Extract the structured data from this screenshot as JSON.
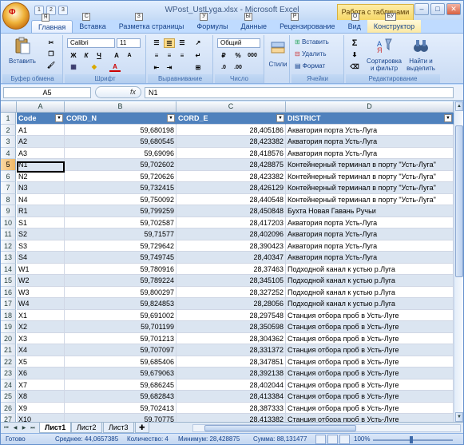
{
  "window": {
    "title": "WPost_UstLyga.xlsx - Microsoft Excel",
    "context_header": "Работа с таблицами",
    "controls": [
      "–",
      "□",
      "✕"
    ]
  },
  "office_button": {
    "keytip": "Ф"
  },
  "quick_access": [
    "1",
    "2",
    "3"
  ],
  "tabs": [
    {
      "label": "Главная",
      "keytip": "Я"
    },
    {
      "label": "Вставка",
      "keytip": "С"
    },
    {
      "label": "Разметка страницы",
      "keytip": "З"
    },
    {
      "label": "Формулы",
      "keytip": "У"
    },
    {
      "label": "Данные",
      "keytip": "Ы"
    },
    {
      "label": "Рецензирование",
      "keytip": "Р"
    },
    {
      "label": "Вид",
      "keytip": "О"
    },
    {
      "label": "Конструктор",
      "keytip": "БУ"
    }
  ],
  "ribbon": {
    "clipboard": {
      "label": "Буфер обмена",
      "paste": "Вставить"
    },
    "font": {
      "label": "Шрифт",
      "name": "Calibri",
      "size": "11",
      "bold": "Ж",
      "italic": "К",
      "underline": "Ч"
    },
    "alignment": {
      "label": "Выравнивание"
    },
    "number": {
      "label": "Число",
      "format": "Общий",
      "percent": "%",
      "thousands": "000"
    },
    "styles": {
      "label": "Стили"
    },
    "cells": {
      "label": "Ячейки",
      "insert": "Вставить",
      "delete": "Удалить",
      "format": "Формат"
    },
    "editing": {
      "label": "Редактирование",
      "sort": "Сортировка и фильтр",
      "find": "Найти и выделить",
      "sigma": "Σ"
    }
  },
  "formula_bar": {
    "name_box": "A5",
    "fx": "fx",
    "content": "N1"
  },
  "columns": [
    "A",
    "B",
    "C",
    "D"
  ],
  "headers": [
    "Code",
    "CORD_N",
    "CORD_E",
    "DISTRICT"
  ],
  "rows": [
    {
      "n": "2",
      "code": "A1",
      "n_val": "59,680198",
      "e_val": "28,405186",
      "district": "Акватория порта Усть-Луга"
    },
    {
      "n": "3",
      "code": "A2",
      "n_val": "59,680545",
      "e_val": "28,423382",
      "district": "Акватория порта Усть-Луга"
    },
    {
      "n": "4",
      "code": "A3",
      "n_val": "59,69096",
      "e_val": "28,418576",
      "district": "Акватория порта Усть-Луга"
    },
    {
      "n": "5",
      "code": "N1",
      "n_val": "59,702602",
      "e_val": "28,428875",
      "district": "Контейнерный терминал в порту \"Усть-Луга\""
    },
    {
      "n": "6",
      "code": "N2",
      "n_val": "59,720626",
      "e_val": "28,423382",
      "district": "Контейнерный терминал в порту \"Усть-Луга\""
    },
    {
      "n": "7",
      "code": "N3",
      "n_val": "59,732415",
      "e_val": "28,426129",
      "district": "Контейнерный терминал в порту \"Усть-Луга\""
    },
    {
      "n": "8",
      "code": "N4",
      "n_val": "59,750092",
      "e_val": "28,440548",
      "district": "Контейнерный терминал в порту \"Усть-Луга\""
    },
    {
      "n": "9",
      "code": "R1",
      "n_val": "59,799259",
      "e_val": "28,450848",
      "district": "Бухта Новая Гавань Ручьи"
    },
    {
      "n": "10",
      "code": "S1",
      "n_val": "59,702587",
      "e_val": "28,417203",
      "district": "Акватория порта Усть-Луга"
    },
    {
      "n": "11",
      "code": "S2",
      "n_val": "59,71577",
      "e_val": "28,402096",
      "district": "Акватория порта Усть-Луга"
    },
    {
      "n": "12",
      "code": "S3",
      "n_val": "59,729642",
      "e_val": "28,390423",
      "district": "Акватория порта Усть-Луга"
    },
    {
      "n": "13",
      "code": "S4",
      "n_val": "59,749745",
      "e_val": "28,40347",
      "district": "Акватория порта Усть-Луга"
    },
    {
      "n": "14",
      "code": "W1",
      "n_val": "59,780916",
      "e_val": "28,37463",
      "district": "Подходной канал к устью р.Луга"
    },
    {
      "n": "15",
      "code": "W2",
      "n_val": "59,789224",
      "e_val": "28,345105",
      "district": "Подходной канал к устью р.Луга"
    },
    {
      "n": "16",
      "code": "W3",
      "n_val": "59,800297",
      "e_val": "28,327252",
      "district": "Подходной канал к устью р.Луга"
    },
    {
      "n": "17",
      "code": "W4",
      "n_val": "59,824853",
      "e_val": "28,28056",
      "district": "Подходной канал к устью р.Луга"
    },
    {
      "n": "18",
      "code": "X1",
      "n_val": "59,691002",
      "e_val": "28,297548",
      "district": "Станция отбора проб в Усть-Луге"
    },
    {
      "n": "19",
      "code": "X2",
      "n_val": "59,701199",
      "e_val": "28,350598",
      "district": "Станция отбора проб в Усть-Луге"
    },
    {
      "n": "20",
      "code": "X3",
      "n_val": "59,701213",
      "e_val": "28,304362",
      "district": "Станция отбора проб в Усть-Луге"
    },
    {
      "n": "21",
      "code": "X4",
      "n_val": "59,707097",
      "e_val": "28,331372",
      "district": "Станция отбора проб в Усть-Луге"
    },
    {
      "n": "22",
      "code": "X5",
      "n_val": "59,685406",
      "e_val": "28,347851",
      "district": "Станция отбора проб в Усть-Луге"
    },
    {
      "n": "23",
      "code": "X6",
      "n_val": "59,679063",
      "e_val": "28,392138",
      "district": "Станция отбора проб в Усть-Луге"
    },
    {
      "n": "24",
      "code": "X7",
      "n_val": "59,686245",
      "e_val": "28,402044",
      "district": "Станция отбора проб в Усть-Луге"
    },
    {
      "n": "25",
      "code": "X8",
      "n_val": "59,682843",
      "e_val": "28,413384",
      "district": "Станция отбора проб в Усть-Луге"
    },
    {
      "n": "26",
      "code": "X9",
      "n_val": "59,702413",
      "e_val": "28,387333",
      "district": "Станция отбора проб в Усть-Луге"
    },
    {
      "n": "27",
      "code": "X10",
      "n_val": "59,70775",
      "e_val": "28,413382",
      "district": "Станция отбора проб в Усть-Луге"
    }
  ],
  "sheets": [
    "Лист1",
    "Лист2",
    "Лист3"
  ],
  "status": {
    "ready": "Готово",
    "average": "Среднее: 44,0657385",
    "count": "Количество: 4",
    "min": "Минимум: 28,428875",
    "sum": "Сумма: 88,131477",
    "zoom": "100%"
  }
}
